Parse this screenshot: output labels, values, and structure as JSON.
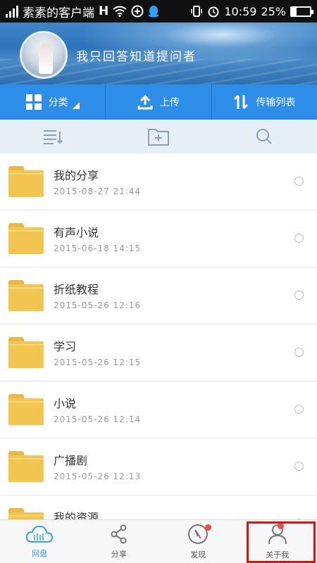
{
  "statusbar": {
    "carrier": "素素的客户端",
    "network": "H",
    "time": "10:59",
    "battery": "25%",
    "battery_level": 0.25
  },
  "header": {
    "username": "我只回答知道提问者"
  },
  "toolbar": {
    "category_label": "分类",
    "upload_label": "上传",
    "transfer_label": "传输列表"
  },
  "subbar": {
    "icons": [
      "sort-list-icon",
      "add-folder-icon",
      "search-icon"
    ]
  },
  "files": [
    {
      "name": "我的分享",
      "date": "2015-08-27 21:44"
    },
    {
      "name": "有声小说",
      "date": "2015-06-18 14:15"
    },
    {
      "name": "折纸教程",
      "date": "2015-05-26 12:16"
    },
    {
      "name": "学习",
      "date": "2015-05-26 12:15"
    },
    {
      "name": "小说",
      "date": "2015-05-26 12:14"
    },
    {
      "name": "广播剧",
      "date": "2015-05-26 12:13"
    },
    {
      "name": "我的资源",
      "date": ""
    }
  ],
  "tabs": {
    "netdisk": "网盘",
    "share": "分享",
    "discover": "发现",
    "about": "关于我"
  },
  "colors": {
    "accent": "#2c8ee8",
    "folder": "#f2c450",
    "badge": "#f44b4b",
    "highlight": "#e01010"
  }
}
